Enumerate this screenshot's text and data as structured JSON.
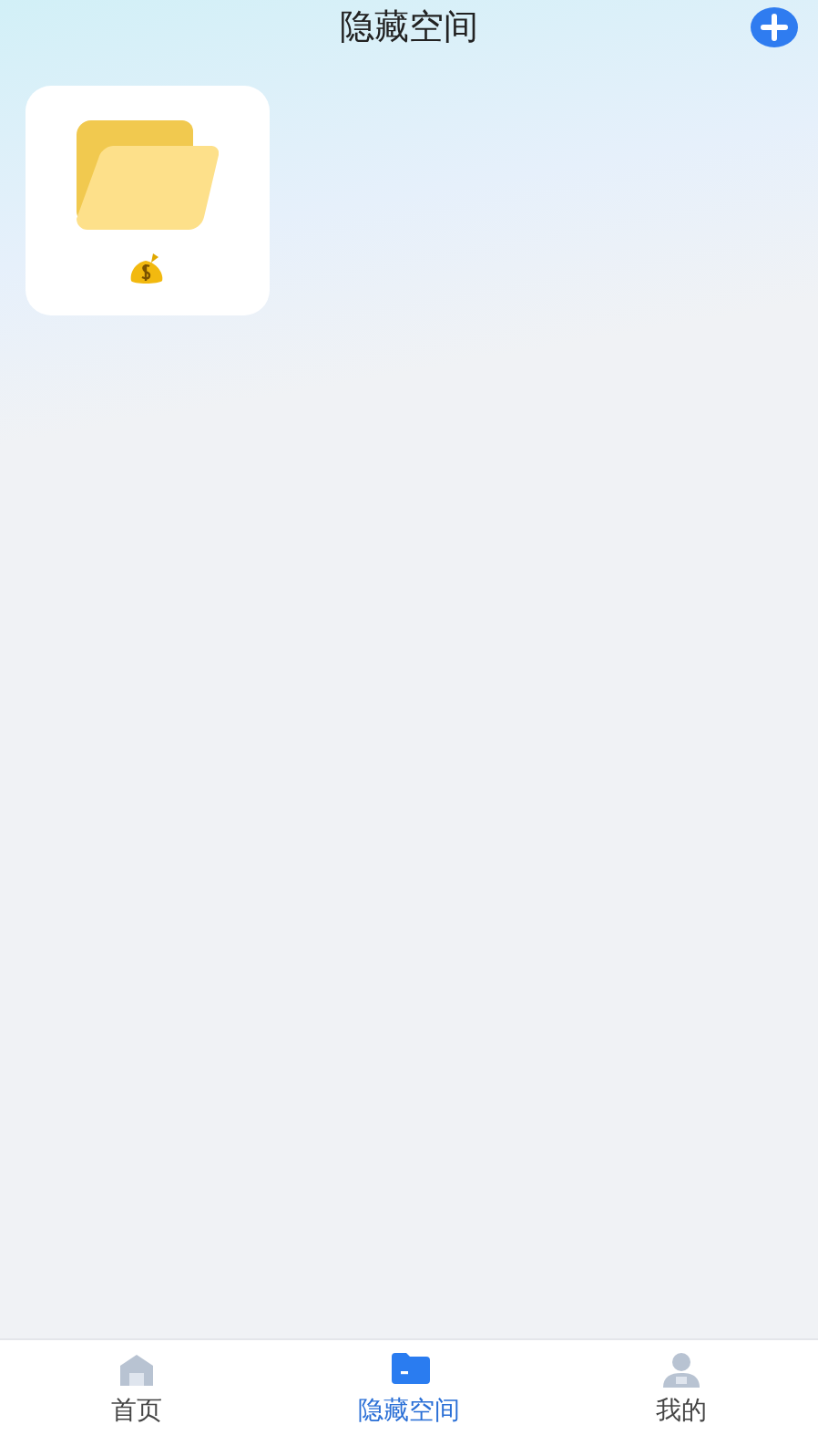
{
  "header": {
    "title": "隐藏空间"
  },
  "folders": [
    {
      "kind": "folder"
    }
  ],
  "tabs": [
    {
      "label": "首页",
      "kind": "home",
      "selected": false
    },
    {
      "label": "隐藏空间",
      "kind": "space",
      "selected": true
    },
    {
      "label": "我的",
      "kind": "profile",
      "selected": false
    }
  ]
}
